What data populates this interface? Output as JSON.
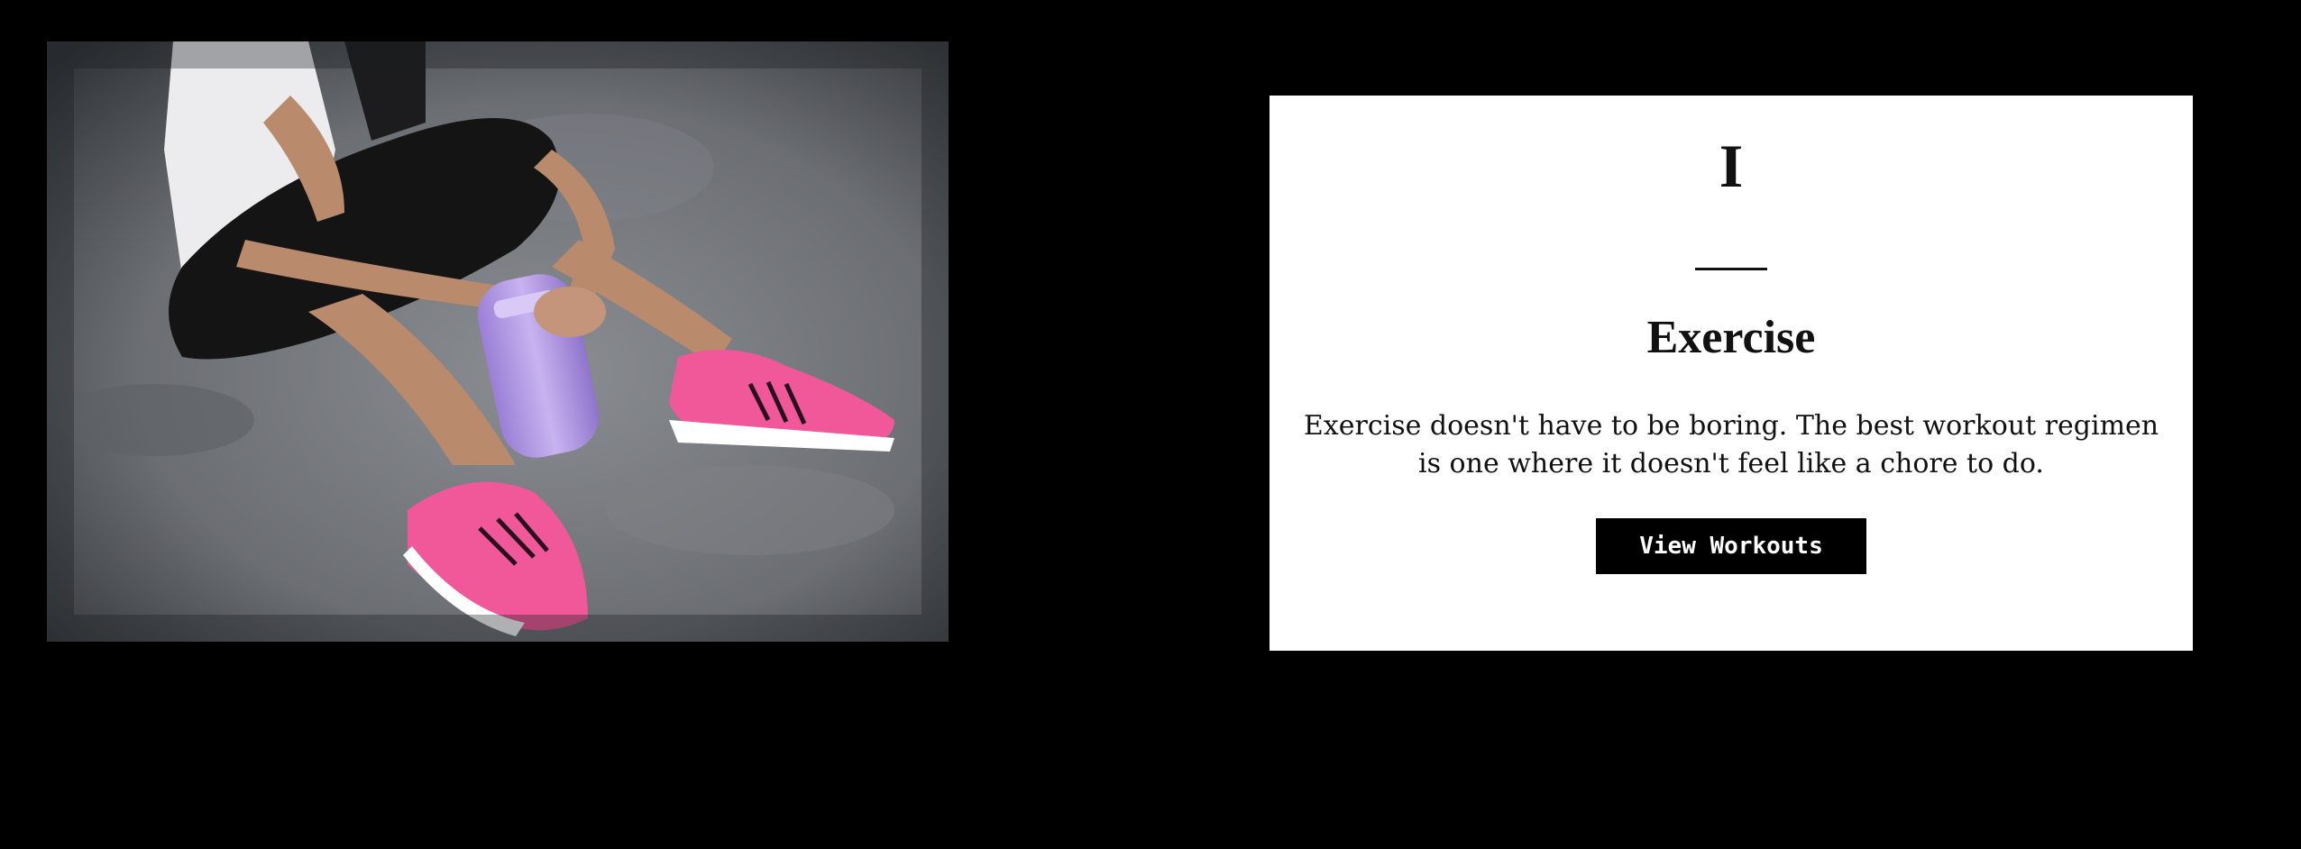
{
  "hero_image": {
    "icon": "photo-woman-sneakers-water-bottle",
    "colors": {
      "floor": "#6b6e73",
      "shoes": "#f0589a",
      "bottle": "#b59be6",
      "leggings": "#141414",
      "skin": "#b98a6c"
    }
  },
  "card": {
    "numeral": "I",
    "title": "Exercise",
    "description": "Exercise doesn't have to be boring. The best workout regimen is one where it doesn't feel like a chore to do.",
    "button_label": "View Workouts"
  },
  "colors": {
    "page_background": "#000000",
    "card_background": "#ffffff",
    "button_background": "#000000",
    "button_text": "#ffffff",
    "text": "#111111"
  }
}
